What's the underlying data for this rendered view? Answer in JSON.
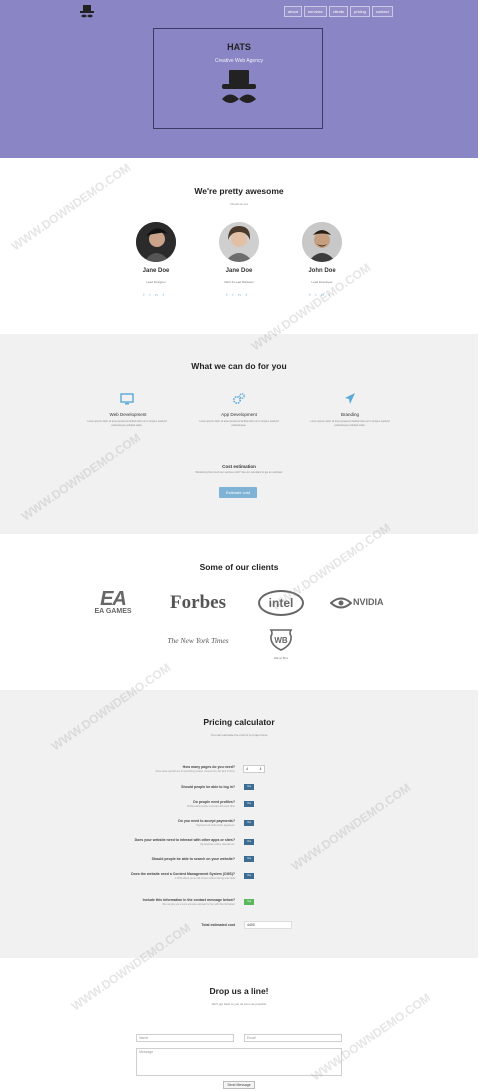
{
  "nav": {
    "items": [
      "about",
      "services",
      "clients",
      "pricing",
      "contact"
    ]
  },
  "hero": {
    "title": "HATS",
    "subtitle": "Creative Web Agency"
  },
  "team": {
    "title": "We're pretty awesome",
    "subtitle": "Check us out",
    "members": [
      {
        "name": "Jane Doe",
        "role": "Lead Designer"
      },
      {
        "name": "Jane Doe",
        "role": "CEO & Lead Marketer"
      },
      {
        "name": "John Doe",
        "role": "Lead Developer"
      }
    ],
    "social_icons": [
      "facebook-icon",
      "linkedin-icon",
      "twitter-icon"
    ]
  },
  "services": {
    "title": "What we can do for you",
    "items": [
      {
        "title": "Web Development",
        "text": "Lorem ipsum dolor sit amet praesent facilisis felis vel in tempus eleifend pellentesque volutpat etiam.",
        "icon": "monitor-icon"
      },
      {
        "title": "App Development",
        "text": "Lorem ipsum dolor sit amet praesent facilisis felis vel in tempus eleifend pellentesque.",
        "icon": "gears-icon"
      },
      {
        "title": "Branding",
        "text": "Lorem ipsum dolor sit amet praesent facilisis felis vel in tempus eleifend pellentesque volutpat etiam.",
        "icon": "rocket-icon"
      }
    ],
    "cost": {
      "title": "Cost estimation",
      "text": "Wondering how much our services cost? Use our calculator to get an estimate!",
      "button": "Estimate cost"
    }
  },
  "clients": {
    "title": "Some of our clients",
    "logos": [
      "EA GAMES",
      "Forbes",
      "intel",
      "NVIDIA",
      "The New York Times",
      "Warner Bros"
    ]
  },
  "pricing": {
    "title": "Pricing calculator",
    "subtitle": "You can estimate the cost of a project here",
    "questions": [
      {
        "label": "How many pages do you need?",
        "help": "Some basic specific text for describing content. Content info, this kind of thing.",
        "value": "4"
      },
      {
        "label": "Should people be able to log in?",
        "help": "",
        "value": "Yes"
      },
      {
        "label": "Do people need profiles?",
        "help": "Profiles allow people to interact with each other",
        "value": "Yes"
      },
      {
        "label": "Do you need to accept payments?",
        "help": "Payments via credit cards, paypal etc.",
        "value": "Yes"
      },
      {
        "label": "Does your website need to interact with other apps or sites?",
        "help": "Eg facebook, twitter, calendar etc.",
        "value": "Yes"
      },
      {
        "label": "Should people be able to search on your website?",
        "help": "",
        "value": "Yes"
      },
      {
        "label": "Does the website need a Content Management System (CMS)?",
        "help": "A CMS allows you to edit content without having code skills",
        "value": "Yes"
      },
      {
        "label": "Include this information in the contact message below?",
        "help": "We can give you a more accurate estimate by then with this information",
        "value": "Yes"
      }
    ],
    "total_label": "Total estimated cost",
    "total_value": "4400"
  },
  "contact": {
    "title": "Drop us a line!",
    "subtitle": "We'll get back to you as soon as possible",
    "name_placeholder": "Name",
    "email_placeholder": "Email",
    "message_placeholder": "Message",
    "button": "Send Message"
  },
  "watermark": "WWW.DOWNDEMO.COM",
  "colors": {
    "hero_bg": "#8a85c4",
    "accent": "#3e6d93",
    "button_light": "#7fb3d5"
  }
}
